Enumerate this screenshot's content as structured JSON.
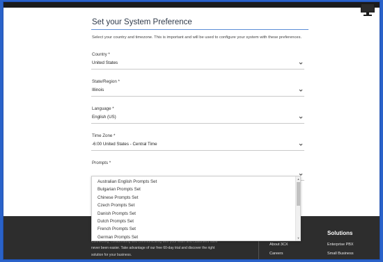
{
  "page": {
    "title": "Set your System Preference",
    "intro": "Select your country and timezone. This is important and will be used to configure your system with these preferences."
  },
  "fields": {
    "country": {
      "label": "Country *",
      "value": "United States"
    },
    "state": {
      "label": "State/Region *",
      "value": "Illinois"
    },
    "language": {
      "label": "Language *",
      "value": "English (US)"
    },
    "timezone": {
      "label": "Time Zone *",
      "value": "-6:00 United States - Central Time"
    },
    "prompts": {
      "label": "Prompts *",
      "value": ""
    }
  },
  "prompts_options": [
    "Australian English Prompts Set",
    "Bulgarian Prompts Set",
    "Chinese Prompts Set",
    "Czech Prompts Set",
    "Danish Prompts Set",
    "Dutch Prompts Set",
    "French Prompts Set",
    "German Prompts Set"
  ],
  "footer": {
    "text": "never been easier. Take advantage of our free 60-day trial and discover the right",
    "text_blur": "Connecting, collaborating and communicating with your team and customers have",
    "text_cut": "solution for your business.",
    "links": [
      "About 3CX",
      "Careers"
    ],
    "solutions_heading": "Solutions",
    "solutions_links": [
      "Enterprise PBX",
      "Small Business"
    ]
  },
  "icons": {
    "chevron": "chevron-down-icon",
    "corner": "monitor-icon"
  },
  "colors": {
    "accent_line": "#5a8dd6",
    "frame_bg": "#2a62c9",
    "footer_bg": "#2d2d2d"
  }
}
